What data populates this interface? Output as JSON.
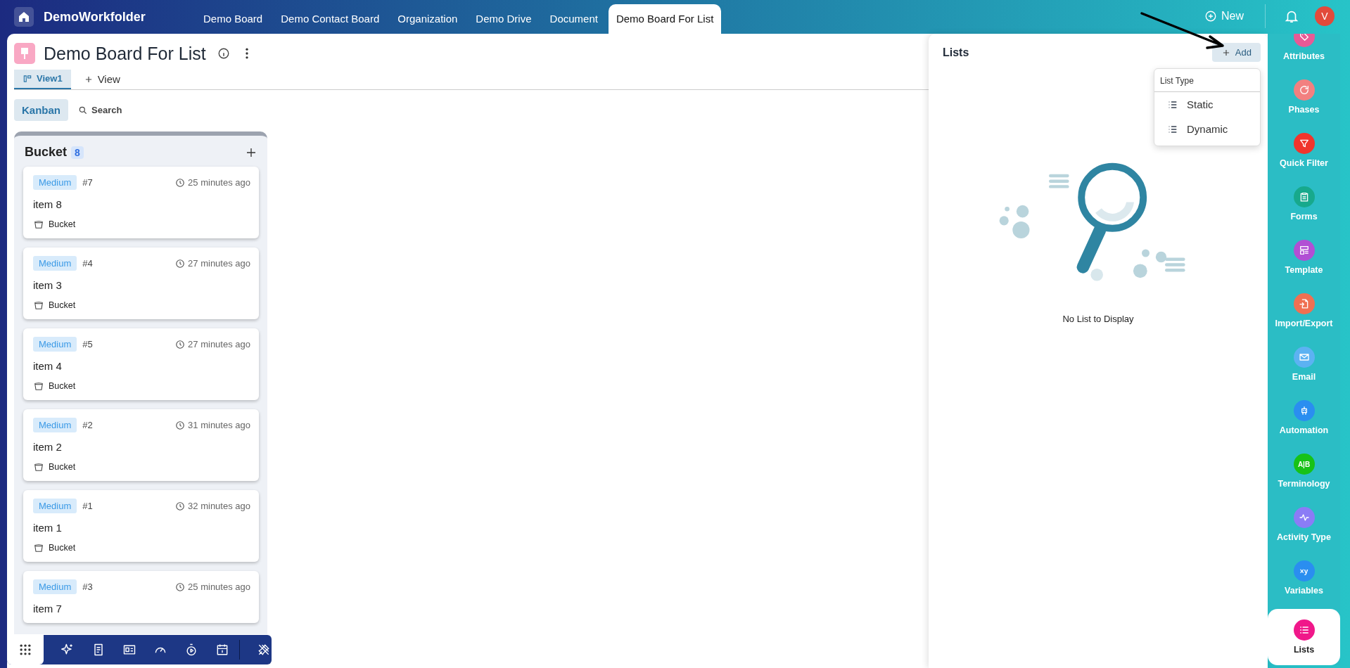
{
  "app": {
    "title": "DemoWorkfolder"
  },
  "top_tabs": [
    {
      "label": "Demo Board",
      "selected": false
    },
    {
      "label": "Demo Contact Board",
      "selected": false
    },
    {
      "label": "Organization",
      "selected": false
    },
    {
      "label": "Demo Drive",
      "selected": false
    },
    {
      "label": "Document",
      "selected": false
    },
    {
      "label": "Demo Board For List",
      "selected": true
    }
  ],
  "header_actions": {
    "new_label": "New",
    "avatar_initial": "V"
  },
  "board": {
    "title": "Demo Board For List",
    "views": [
      {
        "label": "View1",
        "selected": true
      }
    ],
    "add_view_label": "View",
    "modes": [
      {
        "label": "Kanban",
        "selected": true
      }
    ],
    "search_label": "Search"
  },
  "column": {
    "title": "Bucket",
    "count": "8",
    "cards": [
      {
        "priority": "Medium",
        "number": "#7",
        "time": "25 minutes ago",
        "title": "item 8",
        "bucket": "Bucket"
      },
      {
        "priority": "Medium",
        "number": "#4",
        "time": "27 minutes ago",
        "title": "item 3",
        "bucket": "Bucket"
      },
      {
        "priority": "Medium",
        "number": "#5",
        "time": "27 minutes ago",
        "title": "item 4",
        "bucket": "Bucket"
      },
      {
        "priority": "Medium",
        "number": "#2",
        "time": "31 minutes ago",
        "title": "item 2",
        "bucket": "Bucket"
      },
      {
        "priority": "Medium",
        "number": "#1",
        "time": "32 minutes ago",
        "title": "item 1",
        "bucket": "Bucket"
      },
      {
        "priority": "Medium",
        "number": "#3",
        "time": "25 minutes ago",
        "title": "item 7"
      }
    ]
  },
  "lists_panel": {
    "title": "Lists",
    "add_label": "Add",
    "menu": {
      "header": "List Type",
      "items": [
        "Static",
        "Dynamic"
      ]
    },
    "empty_message": "No List to Display"
  },
  "sidebar": [
    {
      "label": "Attributes",
      "color": "#e85a96",
      "selected": false
    },
    {
      "label": "Phases",
      "color": "#f28080",
      "selected": false
    },
    {
      "label": "Quick Filter",
      "color": "#f0352c",
      "selected": false
    },
    {
      "label": "Forms",
      "color": "#17a98c",
      "selected": false
    },
    {
      "label": "Template",
      "color": "#b14fd4",
      "selected": false
    },
    {
      "label": "Import/Export",
      "color": "#ef7052",
      "selected": false
    },
    {
      "label": "Email",
      "color": "#5cb2f2",
      "selected": false
    },
    {
      "label": "Automation",
      "color": "#2a8ef0",
      "selected": false
    },
    {
      "label": "Terminology",
      "color": "#17c217",
      "selected": false,
      "glyph": "A|B"
    },
    {
      "label": "Activity Type",
      "color": "#8b7cf6",
      "selected": false
    },
    {
      "label": "Variables",
      "color": "#2a8ef0",
      "selected": false,
      "glyph": "×y"
    },
    {
      "label": "Lists",
      "color": "#f0188a",
      "selected": true
    }
  ]
}
